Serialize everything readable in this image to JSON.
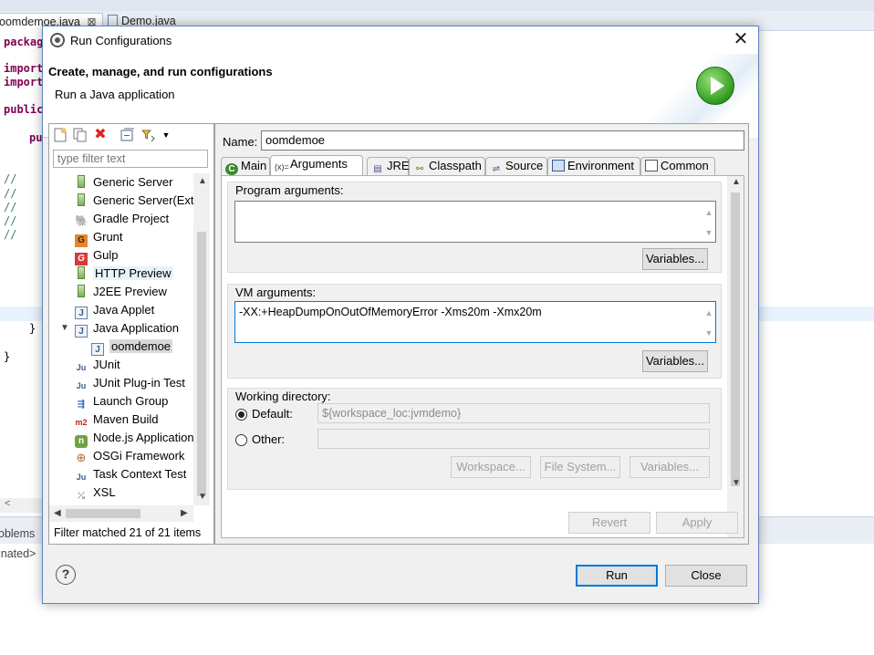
{
  "ide": {
    "tabs": [
      {
        "label": "oomdemoe.java",
        "close": "⊠"
      },
      {
        "label": "Demo.java"
      }
    ],
    "code": {
      "l1": "packag",
      "l2": "import",
      "l3": "import",
      "l4": "public",
      "l5": "pu",
      "comments": [
        "//",
        "//",
        "//",
        "//",
        "//"
      ],
      "brace1": "}",
      "brace2": "}"
    },
    "hscroll_left": "<",
    "bottom_tab": "oblems",
    "bottom_status": "inated>"
  },
  "dialog": {
    "title": "Run Configurations",
    "close": "✕",
    "banner_title": "Create, manage, and run configurations",
    "banner_subtitle": "Run a Java application",
    "filter_placeholder": "type filter text",
    "tree": [
      {
        "label": "Generic Server",
        "icon": "server-icon"
      },
      {
        "label": "Generic Server(Exte",
        "icon": "server-icon"
      },
      {
        "label": "Gradle Project",
        "icon": "gradle-icon"
      },
      {
        "label": "Grunt",
        "icon": "grunt-icon"
      },
      {
        "label": "Gulp",
        "icon": "gulp-icon"
      },
      {
        "label": "HTTP Preview",
        "icon": "server-icon"
      },
      {
        "label": "J2EE Preview",
        "icon": "server-icon"
      },
      {
        "label": "Java Applet",
        "icon": "applet-icon"
      },
      {
        "label": "Java Application",
        "icon": "java-app-icon",
        "expanded": true
      },
      {
        "label": "oomdemoe",
        "icon": "java-app-icon",
        "child": true,
        "selected": true
      },
      {
        "label": "JUnit",
        "icon": "junit-icon"
      },
      {
        "label": "JUnit Plug-in Test",
        "icon": "junit-plugin-icon"
      },
      {
        "label": "Launch Group",
        "icon": "launch-group-icon"
      },
      {
        "label": "Maven Build",
        "icon": "maven-icon"
      },
      {
        "label": "Node.js Application",
        "icon": "nodejs-icon"
      },
      {
        "label": "OSGi Framework",
        "icon": "osgi-icon"
      },
      {
        "label": "Task Context Test",
        "icon": "task-context-icon"
      },
      {
        "label": "XSL",
        "icon": "xsl-icon"
      }
    ],
    "filter_status": "Filter matched 21 of 21 items",
    "name_label": "Name:",
    "name_value": "oomdemoe",
    "tabs": [
      {
        "label": "Main",
        "icon": "main-tab-icon"
      },
      {
        "label": "Arguments",
        "icon": "arguments-tab-icon",
        "active": true
      },
      {
        "label": "JRE",
        "icon": "jre-tab-icon"
      },
      {
        "label": "Classpath",
        "icon": "classpath-tab-icon"
      },
      {
        "label": "Source",
        "icon": "source-tab-icon"
      },
      {
        "label": "Environment",
        "icon": "environment-tab-icon"
      },
      {
        "label": "Common",
        "icon": "common-tab-icon"
      }
    ],
    "program_args_label": "Program arguments:",
    "program_args_value": "",
    "variables_label": "Variables...",
    "vm_args_label": "VM arguments:",
    "vm_args_value": "-XX:+HeapDumpOnOutOfMemoryError -Xms20m -Xmx20m",
    "working_dir_label": "Working directory:",
    "default_label": "Default:",
    "default_value": "${workspace_loc:jvmdemo}",
    "other_label": "Other:",
    "other_value": "",
    "workspace_label": "Workspace...",
    "filesystem_label": "File System...",
    "revert_label": "Revert",
    "apply_label": "Apply",
    "run_label": "Run",
    "close_label": "Close",
    "help": "?"
  },
  "colors": {
    "accent": "#0078d7",
    "selection": "#d9d9d9",
    "keyword": "#7f0055",
    "comment": "#3f7f5f"
  }
}
